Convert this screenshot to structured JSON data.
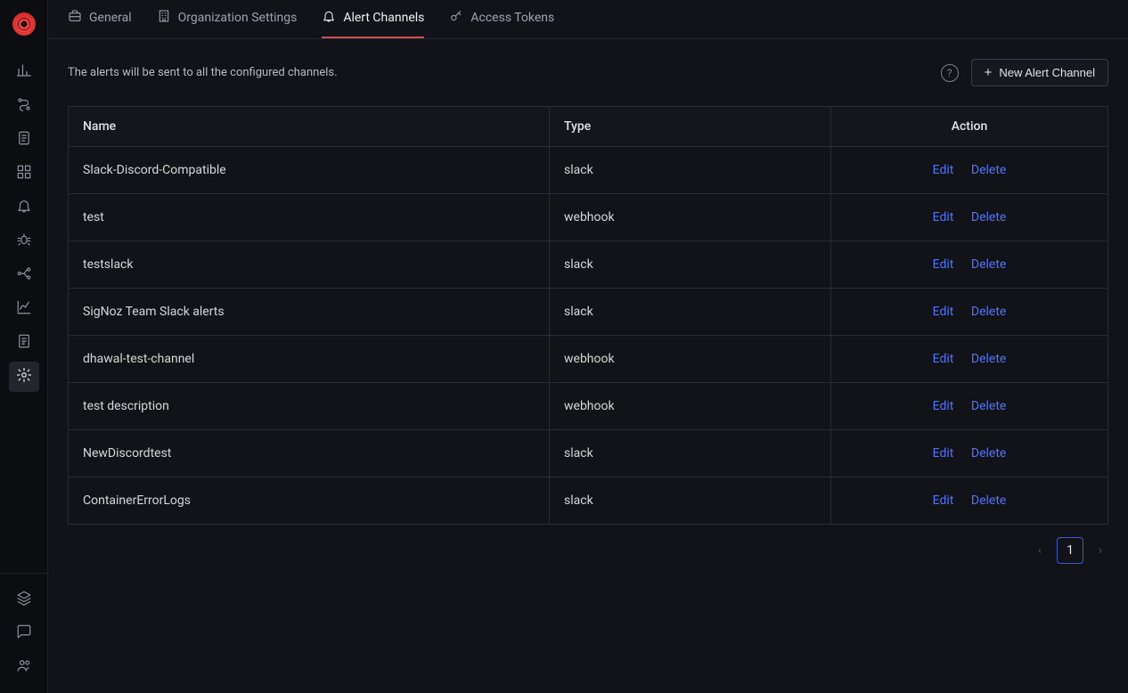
{
  "sidebar": {
    "top_items": [
      {
        "name": "bar-chart-icon"
      },
      {
        "name": "route-icon"
      },
      {
        "name": "scroll-icon"
      },
      {
        "name": "grid-icon"
      },
      {
        "name": "bell-icon"
      },
      {
        "name": "bug-icon"
      },
      {
        "name": "pipeline-icon"
      },
      {
        "name": "area-chart-icon"
      },
      {
        "name": "receipt-icon"
      },
      {
        "name": "gear-icon"
      }
    ],
    "bottom_items": [
      {
        "name": "layers-icon"
      },
      {
        "name": "chat-icon"
      },
      {
        "name": "users-icon"
      }
    ],
    "active_index": 9
  },
  "tabs": [
    {
      "icon": "briefcase-icon",
      "label": "General"
    },
    {
      "icon": "building-icon",
      "label": "Organization Settings"
    },
    {
      "icon": "bell-icon",
      "label": "Alert Channels"
    },
    {
      "icon": "key-icon",
      "label": "Access Tokens"
    }
  ],
  "active_tab": 2,
  "description": "The alerts will be sent to all the configured channels.",
  "buttons": {
    "help_symbol": "?",
    "new_channel": "New Alert Channel"
  },
  "table": {
    "headers": {
      "name": "Name",
      "type": "Type",
      "action": "Action"
    },
    "action_labels": {
      "edit": "Edit",
      "delete": "Delete"
    },
    "rows": [
      {
        "name": "Slack-Discord-Compatible",
        "type": "slack"
      },
      {
        "name": "test",
        "type": "webhook"
      },
      {
        "name": "testslack",
        "type": "slack"
      },
      {
        "name": "SigNoz Team Slack alerts",
        "type": "slack"
      },
      {
        "name": "dhawal-test-channel",
        "type": "webhook"
      },
      {
        "name": "test description",
        "type": "webhook"
      },
      {
        "name": "NewDiscordtest",
        "type": "slack"
      },
      {
        "name": "ContainerErrorLogs",
        "type": "slack"
      }
    ]
  },
  "pagination": {
    "prev": "‹",
    "current": "1",
    "next": "›"
  }
}
